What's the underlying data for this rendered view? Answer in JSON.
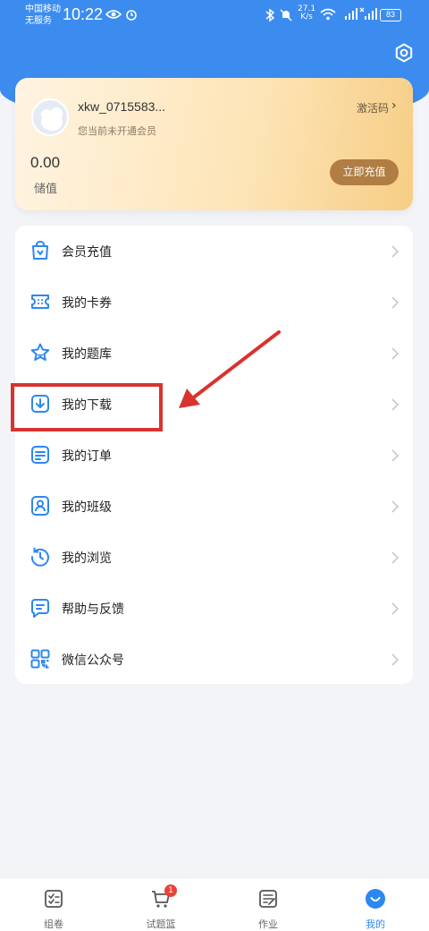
{
  "status_bar": {
    "carrier_line1": "中国移动",
    "carrier_line2": "无服务",
    "time": "10:22",
    "net_speed_value": "27.1",
    "net_speed_unit": "K/s",
    "battery_level": "83"
  },
  "card": {
    "username": "xkw_0715583...",
    "membership_status": "您当前未开通会员",
    "activation_code_label": "激活码",
    "balance_value": "0.00",
    "balance_label": "储值",
    "recharge_button": "立即充值"
  },
  "menu": {
    "items": [
      {
        "label": "会员充值",
        "icon": "bag-icon"
      },
      {
        "label": "我的卡券",
        "icon": "ticket-icon"
      },
      {
        "label": "我的题库",
        "icon": "star-icon"
      },
      {
        "label": "我的下载",
        "icon": "download-icon"
      },
      {
        "label": "我的订单",
        "icon": "order-icon"
      },
      {
        "label": "我的班级",
        "icon": "user-icon"
      },
      {
        "label": "我的浏览",
        "icon": "history-icon"
      },
      {
        "label": "帮助与反馈",
        "icon": "message-icon"
      },
      {
        "label": "微信公众号",
        "icon": "qrcode-icon"
      }
    ]
  },
  "tab_bar": {
    "tabs": [
      {
        "label": "组卷",
        "icon": "paper-icon",
        "active": false
      },
      {
        "label": "试题篮",
        "icon": "cart-icon",
        "active": false,
        "badge": "1"
      },
      {
        "label": "作业",
        "icon": "homework-icon",
        "active": false
      },
      {
        "label": "我的",
        "icon": "profile-icon",
        "active": true
      }
    ]
  },
  "colors": {
    "primary_blue": "#3c8cf0",
    "icon_blue": "#2d87f0",
    "recharge_brown": "#b07d43",
    "annotation_red": "#d8332f",
    "badge_red": "#e8423c"
  }
}
